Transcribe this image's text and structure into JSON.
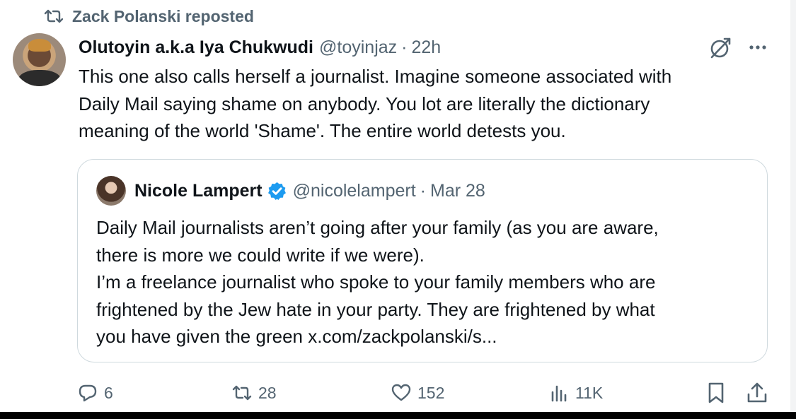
{
  "repost": {
    "label": "Zack Polanski reposted",
    "icon": "repost-icon"
  },
  "tweet": {
    "author_name": "Olutoyin a.k.a Iya Chukwudi",
    "author_handle": "@toyinjaz",
    "separator": "·",
    "time": "22h",
    "text": "This one also calls herself a journalist. Imagine someone associated with\nDaily Mail saying shame on anybody. You lot are literally the dictionary\nmeaning of the world 'Shame'. The entire world detests you."
  },
  "quote": {
    "author_name": "Nicole Lampert",
    "verified": true,
    "author_handle": "@nicolelampert",
    "separator": "·",
    "time": "Mar 28",
    "text": "Daily Mail journalists aren’t going after your family (as you are aware,\nthere is more we could write if we were).\nI’m a freelance journalist who spoke to your family members who are\nfrightened by the Jew hate in your party. They are frightened by what\nyou have given the green x.com/zackpolanski/s..."
  },
  "actions": {
    "replies": "6",
    "reposts": "28",
    "likes": "152",
    "views": "11K"
  },
  "colors": {
    "text": "#0f1419",
    "muted": "#536471",
    "border": "#cfd9de",
    "verified": "#1d9bf0"
  }
}
